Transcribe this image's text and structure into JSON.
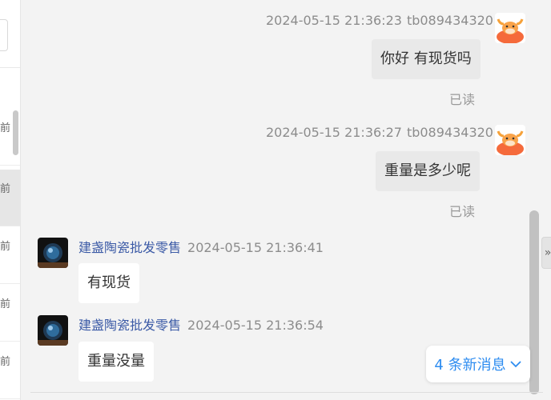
{
  "conversation_list": {
    "items": [
      {
        "ago": "前",
        "selected": false
      },
      {
        "ago": "前",
        "selected": true
      },
      {
        "ago": "前",
        "selected": false
      },
      {
        "ago": "前",
        "selected": false
      },
      {
        "ago": "前",
        "selected": false
      }
    ]
  },
  "messages": [
    {
      "timestamp": "2024-05-15 21:36:23",
      "nick": "tb089434320",
      "text": "你好 有现货吗",
      "read_status": "已读",
      "avatar": "cow-avatar-icon"
    },
    {
      "timestamp": "2024-05-15 21:36:27",
      "nick": "tb089434320",
      "text": "重量是多少呢",
      "read_status": "已读",
      "avatar": "cow-avatar-icon"
    },
    {
      "sender": "建盏陶瓷批发零售",
      "timestamp": "2024-05-15 21:36:41",
      "text": "有现货",
      "avatar": "shop-avatar-icon"
    },
    {
      "sender": "建盏陶瓷批发零售",
      "timestamp": "2024-05-15 21:36:54",
      "text": "重量没量",
      "avatar": "shop-avatar-icon"
    }
  ],
  "new_messages_label": "4 条新消息",
  "collapse_icon_glyph": "»",
  "colors": {
    "link_blue": "#2d8cf0",
    "sender_name": "#3b5aa6",
    "own_bubble": "#e9e9e9",
    "other_bubble": "#ffffff",
    "background": "#f3f3f3"
  }
}
